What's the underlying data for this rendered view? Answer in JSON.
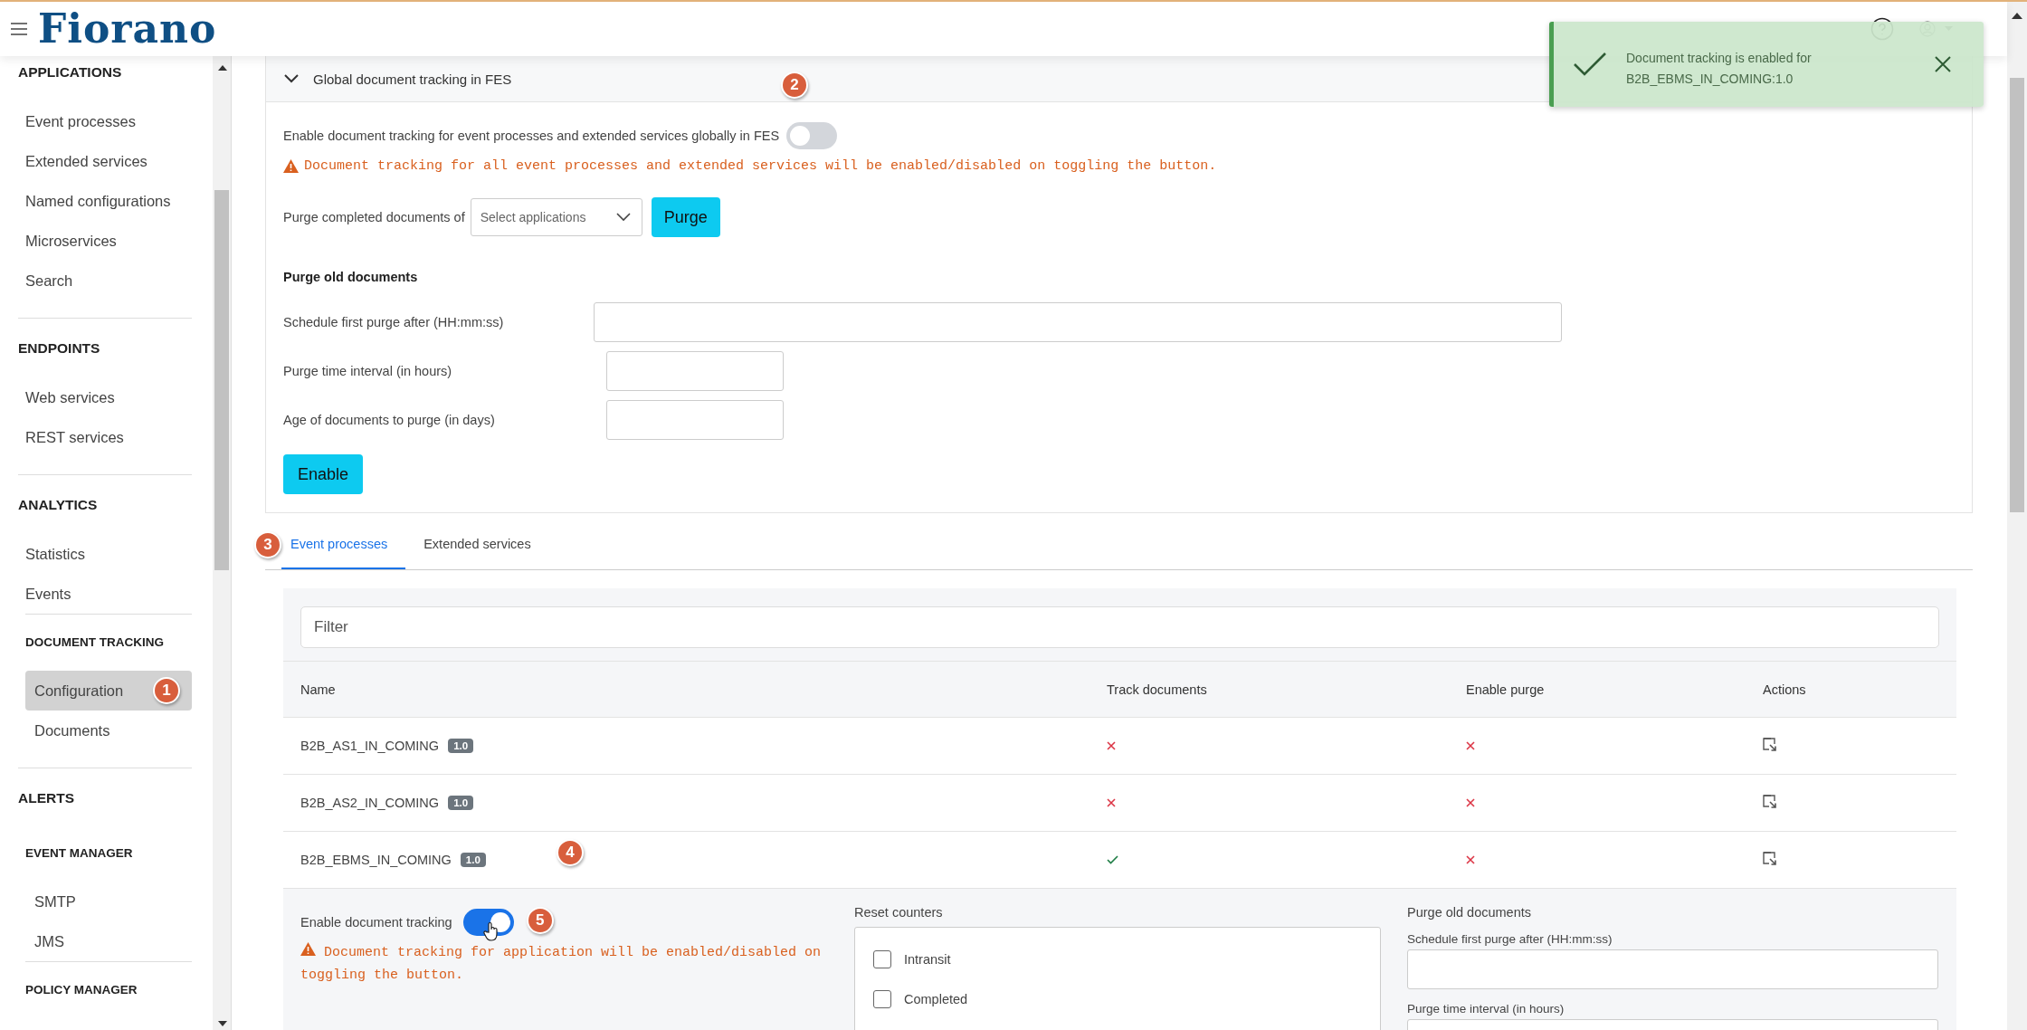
{
  "header": {
    "logo": "Fiorano"
  },
  "sidebar": {
    "entries": [
      {
        "kind": "section",
        "label": "APPLICATIONS"
      },
      {
        "kind": "link",
        "label": "Event processes",
        "selected": false
      },
      {
        "kind": "link",
        "label": "Extended services",
        "selected": false
      },
      {
        "kind": "link",
        "label": "Named configurations",
        "selected": false
      },
      {
        "kind": "link",
        "label": "Microservices",
        "selected": false
      },
      {
        "kind": "link",
        "label": "Search",
        "selected": false
      },
      {
        "kind": "section",
        "label": "ENDPOINTS"
      },
      {
        "kind": "link",
        "label": "Web services",
        "selected": false
      },
      {
        "kind": "link",
        "label": "REST services",
        "selected": false
      },
      {
        "kind": "section",
        "label": "ANALYTICS"
      },
      {
        "kind": "link",
        "label": "Statistics",
        "selected": false
      },
      {
        "kind": "link",
        "label": "Events",
        "selected": false
      },
      {
        "kind": "group",
        "label": "DOCUMENT TRACKING"
      },
      {
        "kind": "link",
        "label": "Configuration",
        "selected": true,
        "callout": "1"
      },
      {
        "kind": "link",
        "label": "Documents",
        "selected": false
      },
      {
        "kind": "section",
        "label": "ALERTS"
      },
      {
        "kind": "group",
        "label": "EVENT MANAGER"
      },
      {
        "kind": "link",
        "label": "SMTP",
        "selected": false
      },
      {
        "kind": "link",
        "label": "JMS",
        "selected": false
      },
      {
        "kind": "group",
        "label": "POLICY MANAGER"
      }
    ]
  },
  "toast": {
    "message": "Document tracking is enabled for B2B_EBMS_IN_COMING:1.0"
  },
  "global": {
    "title": "Global document tracking in FES",
    "expanded": true,
    "toggle": {
      "label": "Enable document tracking for event processes and extended services globally in FES",
      "on": false,
      "callout": "2"
    },
    "warning": "Document tracking for all event processes and extended services will be enabled/disabled on toggling the button.",
    "purge": {
      "label": "Purge completed documents of",
      "placeholder": "Select applications",
      "button": "Purge"
    },
    "schedule_heading": "Purge old documents",
    "fields": [
      {
        "label": "Schedule first purge after (HH:mm:ss)",
        "kind": "wide"
      },
      {
        "label": "Purge time interval (in hours)",
        "kind": "short"
      },
      {
        "label": "Age of documents to purge (in days)",
        "kind": "short"
      }
    ],
    "enable_button": "Enable"
  },
  "tabs": [
    {
      "label": "Event processes",
      "selected": true,
      "callout": "3"
    },
    {
      "label": "Extended services",
      "selected": false
    }
  ],
  "table": {
    "filter_placeholder": "Filter",
    "columns": [
      "Name",
      "Track documents",
      "Enable purge",
      "Actions"
    ],
    "rows": [
      {
        "name": "B2B_AS1_IN_COMING",
        "version": "1.0",
        "track": false,
        "purge": false
      },
      {
        "name": "B2B_AS2_IN_COMING",
        "version": "1.0",
        "track": false,
        "purge": false
      },
      {
        "name": "B2B_EBMS_IN_COMING",
        "version": "1.0",
        "track": true,
        "purge": false,
        "callout": "4"
      }
    ]
  },
  "detail": {
    "toggle_label": "Enable document tracking",
    "on": true,
    "callout": "5",
    "warning": "Document tracking for application will be enabled/disabled on toggling the button.",
    "counters_label": "Reset counters",
    "counters": [
      {
        "label": "Intransit",
        "checked": false
      },
      {
        "label": "Completed",
        "checked": false
      }
    ],
    "purge_heading": "Purge old documents",
    "purge_fields": [
      "Schedule first purge after (HH:mm:ss)",
      "Purge time interval (in hours)"
    ]
  }
}
